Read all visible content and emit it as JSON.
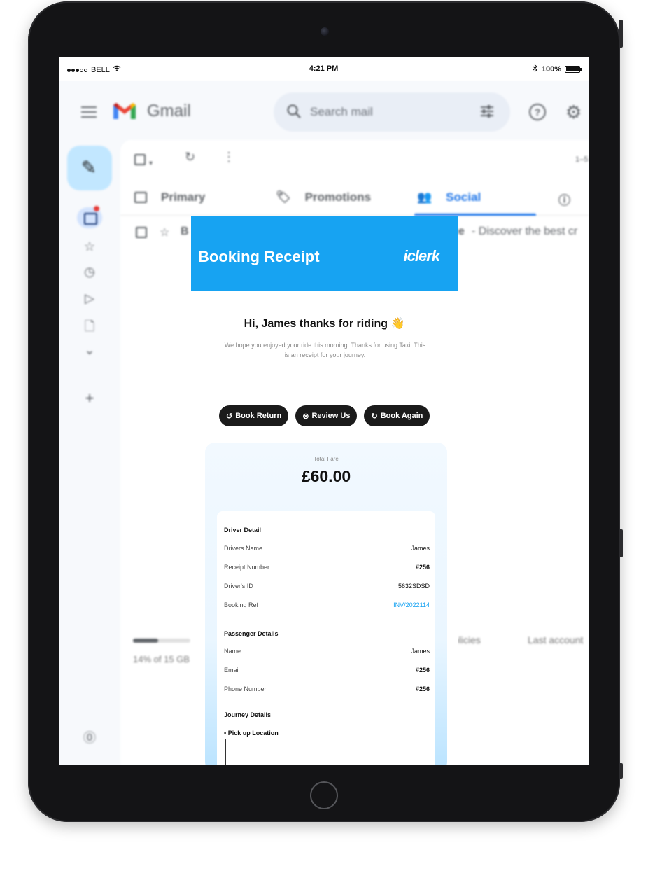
{
  "status_bar": {
    "carrier": "BELL",
    "time": "4:21 PM",
    "battery": "100%"
  },
  "gmail": {
    "app_name": "Gmail",
    "search_placeholder": "Search mail",
    "help_symbol": "?",
    "tabs": [
      {
        "label": "Primary",
        "icon": "inbox-tab-icon"
      },
      {
        "label": "Promotions",
        "icon": "tag-icon"
      },
      {
        "label": "Social",
        "icon": "people-icon"
      }
    ],
    "active_tab": "Social",
    "row_snippet": "- Discover the best cr",
    "row_prefix_left": "B",
    "row_prefix_right": "ce",
    "pagination_hint": "1–5",
    "storage_text": "14% of 15 GB",
    "storage_fraction": 0.14,
    "footer_links": [
      "olicies",
      "Last account"
    ]
  },
  "receipt": {
    "header_title": "Booking Receipt",
    "logo_text": "iclerk",
    "greeting": "Hi, James thanks for riding",
    "greeting_emoji": "👋",
    "intro": "We hope you enjoyed your ride this morning. Thanks for using Taxi. This is an receipt for your journey.",
    "buttons": [
      {
        "icon": "undo-icon",
        "glyph": "↺",
        "label": "Book Return"
      },
      {
        "icon": "star-circle-icon",
        "glyph": "⊗",
        "label": "Review Us"
      },
      {
        "icon": "refresh-icon",
        "glyph": "↻",
        "label": "Book Again"
      }
    ],
    "total_fare_label": "Total Fare",
    "total_fare": "£60.00",
    "driver_section": "Driver Detail",
    "driver": [
      {
        "key": "Drivers Name",
        "value": "James"
      },
      {
        "key": "Receipt Number",
        "value": "#256"
      },
      {
        "key": "Driver's ID",
        "value": "5632SDSD"
      },
      {
        "key": "Booking Ref",
        "value": "INV/2022114"
      }
    ],
    "passenger_section": "Passenger Details",
    "passenger": [
      {
        "key": "Name",
        "value": "James"
      },
      {
        "key": "Email",
        "value": "#256"
      },
      {
        "key": "Phone Number",
        "value": "#256"
      }
    ],
    "journey_section": "Journey Details",
    "pickup_label": "Pick up Location",
    "accent_color": "#17a3f2"
  }
}
